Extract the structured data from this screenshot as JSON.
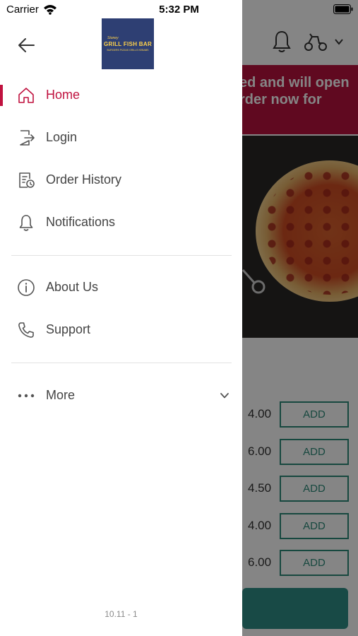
{
  "status_bar": {
    "carrier": "Carrier",
    "time": "5:32 PM"
  },
  "drawer": {
    "logo": {
      "small_text": "Stoney",
      "name": "GRILL FISH BAR",
      "tagline": "BURGERS PIZZAS GRILLS KEBABS"
    },
    "nav_items": [
      {
        "label": "Home",
        "icon": "home-icon",
        "active": true
      },
      {
        "label": "Login",
        "icon": "login-icon",
        "active": false
      },
      {
        "label": "Order History",
        "icon": "order-history-icon",
        "active": false
      },
      {
        "label": "Notifications",
        "icon": "bell-icon",
        "active": false
      }
    ],
    "secondary_items": [
      {
        "label": "About Us",
        "icon": "info-icon"
      },
      {
        "label": "Support",
        "icon": "phone-icon"
      }
    ],
    "more": {
      "label": "More",
      "icon": "ellipsis-icon"
    },
    "version": "10.11 - 1"
  },
  "background": {
    "banner_line1": "ed and will open",
    "banner_line2": "rder now for",
    "menu_rows": [
      {
        "price": "4.00",
        "button": "ADD"
      },
      {
        "price": "6.00",
        "button": "ADD"
      },
      {
        "price": "4.50",
        "button": "ADD"
      },
      {
        "price": "4.00",
        "button": "ADD"
      },
      {
        "price": "6.00",
        "button": "ADD"
      }
    ]
  },
  "colors": {
    "accent": "#c0123f",
    "banner": "#b8123e",
    "teal": "#2c8a7a"
  }
}
